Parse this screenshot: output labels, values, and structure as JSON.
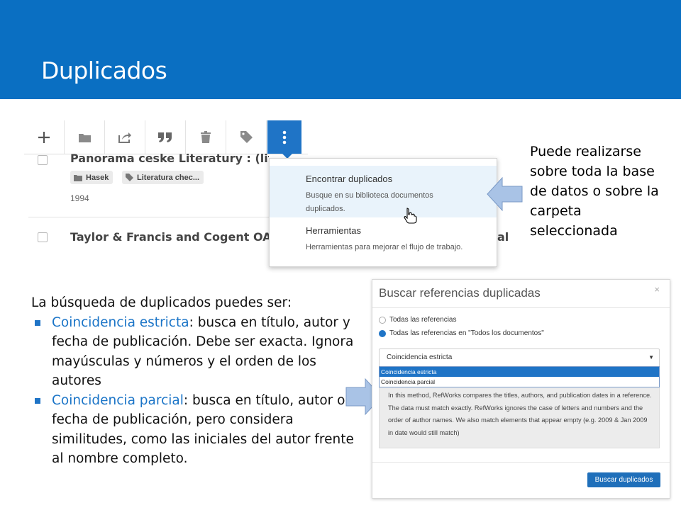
{
  "slide": {
    "title": "Duplicados",
    "header_color": "#0a6fc2",
    "accent_color": "#1f74c6"
  },
  "toolbar": {
    "buttons": [
      {
        "icon": "plus-icon"
      },
      {
        "icon": "folder-icon"
      },
      {
        "icon": "share-icon"
      },
      {
        "icon": "quote-icon"
      },
      {
        "icon": "trash-icon"
      },
      {
        "icon": "tag-icon"
      },
      {
        "icon": "more-vertical-icon",
        "active": true
      }
    ]
  },
  "references": [
    {
      "title": "Panorama ceske Literatury : (literarni de...  ...od pocatku do soucasnosti)",
      "tags": [
        "Hasek",
        "Literatura chec..."
      ],
      "tag_icons": [
        "folder-icon",
        "tag-icon"
      ],
      "year": "1994"
    },
    {
      "title": "Taylor & Francis and Cogent OA launch",
      "title_tail": "al"
    }
  ],
  "menu": {
    "items": [
      {
        "title": "Encontrar duplicados",
        "description": "Busque en su biblioteca documentos duplicados."
      },
      {
        "title": "Herramientas",
        "description": "Herramientas para mejorar el flujo de trabajo."
      }
    ]
  },
  "note_right": "Puede realizarse sobre toda la base de datos o sobre la carpeta seleccionada",
  "left_text": {
    "intro": "La búsqueda de duplicados puedes ser:",
    "bullets": [
      {
        "keyword": "Coincidencia estricta",
        "rest": ": busca en título, autor y fecha de publicación. Debe ser exacta. Ignora mayúsculas y números y el orden de los autores"
      },
      {
        "keyword": "Coincidencia parcial",
        "rest": ": busca en título, autor o fecha de publicación, pero considera similitudes, como las iniciales del autor frente al nombre completo."
      }
    ]
  },
  "modal": {
    "title": "Buscar referencias duplicadas",
    "close": "×",
    "radio_options": [
      {
        "label": "Todas las referencias",
        "selected": false
      },
      {
        "label": "Todas las referencias en \"Todos los documentos\"",
        "selected": true
      }
    ],
    "select_value": "Coincidencia estricta",
    "select_caret": "▼",
    "dropdown_options": [
      "Coincidencia estricta",
      "Coincidencia parcial"
    ],
    "description": "In this method, RefWorks compares the titles, authors, and publication dates in a reference. The data must match exactly. RefWorks ignores the case of letters and numbers and the order of author names. We also match elements that appear empty (e.g. 2009 & Jan 2009 in date would still match)",
    "button": "Buscar duplicados"
  }
}
